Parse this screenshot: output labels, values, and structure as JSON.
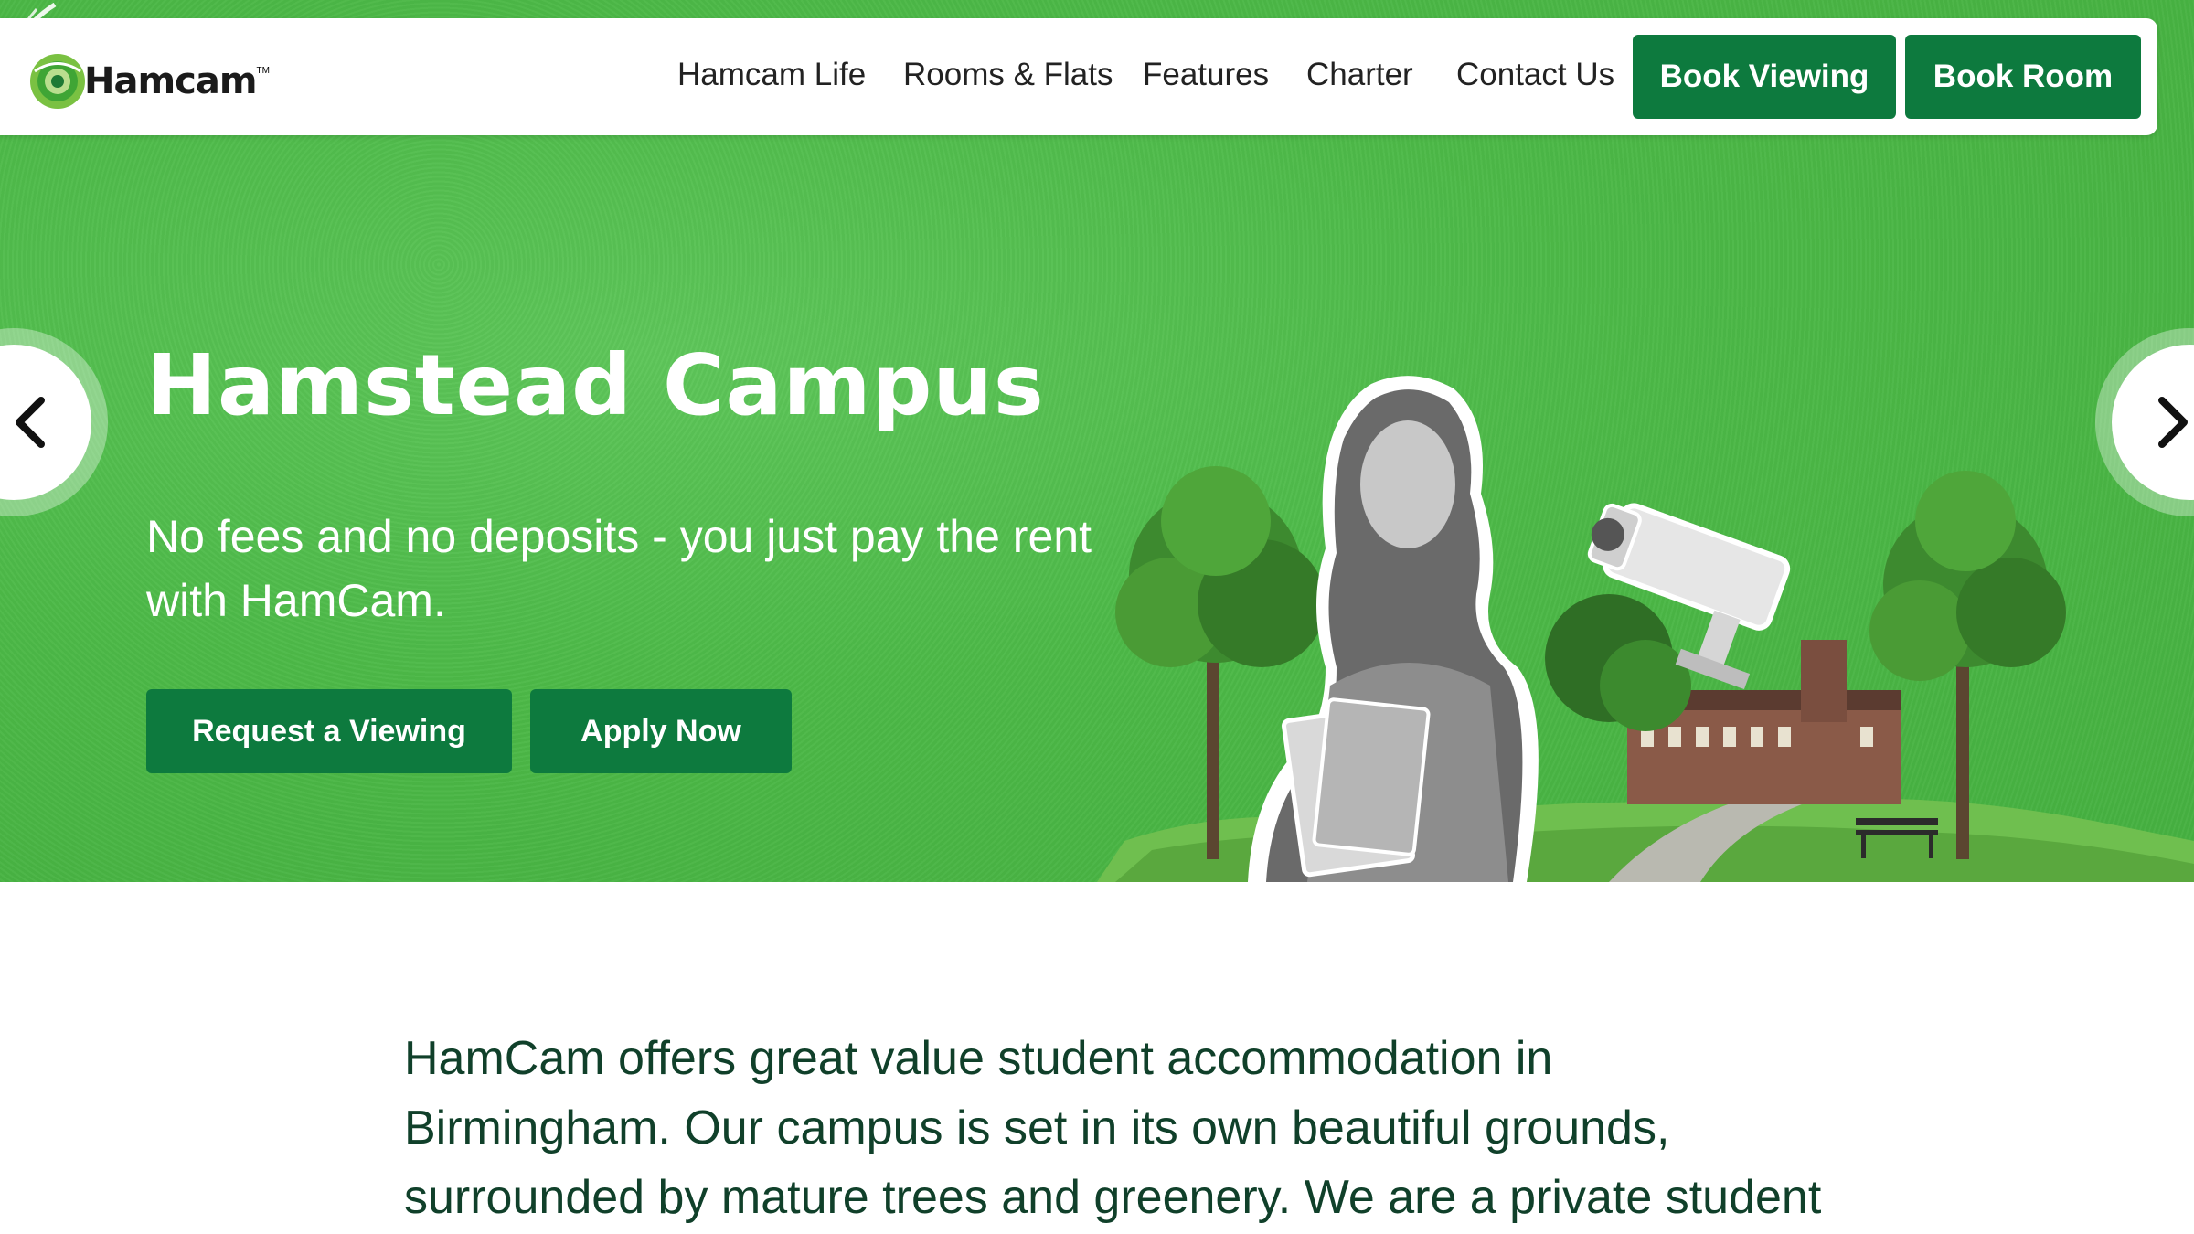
{
  "brand": {
    "name": "Hamcam",
    "tm": "TM"
  },
  "nav": {
    "links": [
      "Hamcam Life",
      "Rooms & Flats",
      "Features",
      "Charter",
      "Contact Us"
    ],
    "book_viewing": "Book Viewing",
    "book_room": "Book Room"
  },
  "hero": {
    "title": "Hamstead Campus",
    "subtitle": "No fees and no deposits - you just pay the rent with HamCam.",
    "request_viewing": "Request a Viewing",
    "apply_now": "Apply Now",
    "prev_icon": "chevron-left-icon",
    "next_icon": "chevron-right-icon"
  },
  "intro": {
    "text": "HamCam offers great value student accommodation in Birmingham. Our campus is set in its own beautiful grounds, surrounded by mature trees and greenery. We are a private student"
  },
  "colors": {
    "brand_green": "#0d7a3e",
    "hero_green": "#4cb947",
    "text_dark_green": "#10402a"
  }
}
